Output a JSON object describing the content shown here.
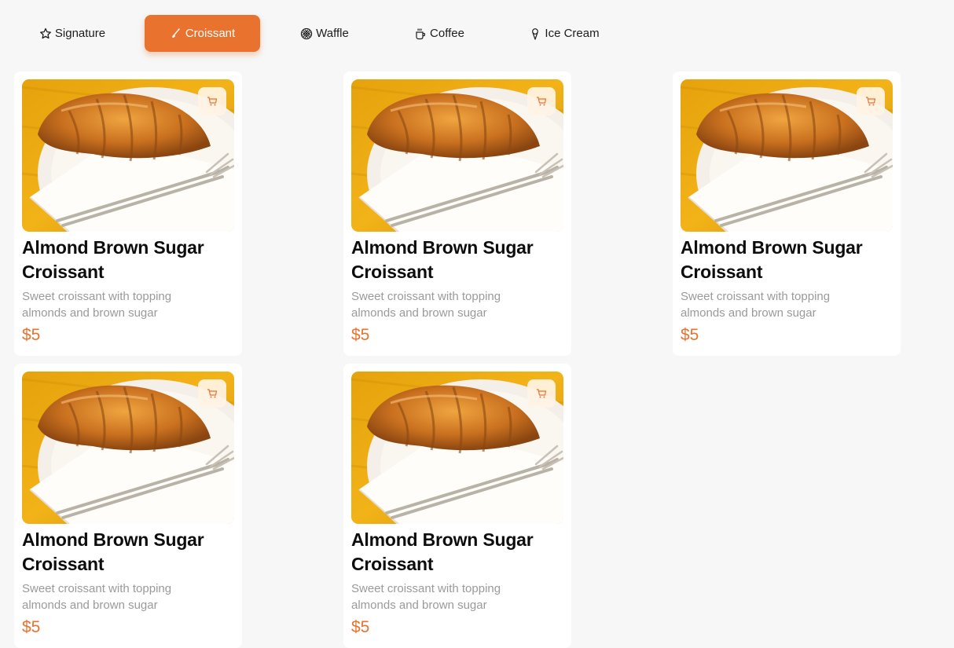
{
  "tabs": [
    {
      "label": "Signature",
      "icon": "star-icon",
      "active": false
    },
    {
      "label": "Croissant",
      "icon": "brush-icon",
      "active": true
    },
    {
      "label": "Waffle",
      "icon": "waffle-icon",
      "active": false
    },
    {
      "label": "Coffee",
      "icon": "coffee-icon",
      "active": false
    },
    {
      "label": "Ice Cream",
      "icon": "ice-cream-icon",
      "active": false
    }
  ],
  "accent_color": "#e8722e",
  "products": [
    {
      "title": "Almond Brown Sugar Croissant",
      "description": "Sweet croissant with topping almonds and brown sugar",
      "price": "$5"
    },
    {
      "title": "Almond Brown Sugar Croissant",
      "description": "Sweet croissant with topping almonds and brown sugar",
      "price": "$5"
    },
    {
      "title": "Almond Brown Sugar Croissant",
      "description": "Sweet croissant with topping almonds and brown sugar",
      "price": "$5"
    },
    {
      "title": "Almond Brown Sugar Croissant",
      "description": "Sweet croissant with topping almonds and brown sugar",
      "price": "$5"
    },
    {
      "title": "Almond Brown Sugar Croissant",
      "description": "Sweet croissant with topping almonds and brown sugar",
      "price": "$5"
    }
  ]
}
